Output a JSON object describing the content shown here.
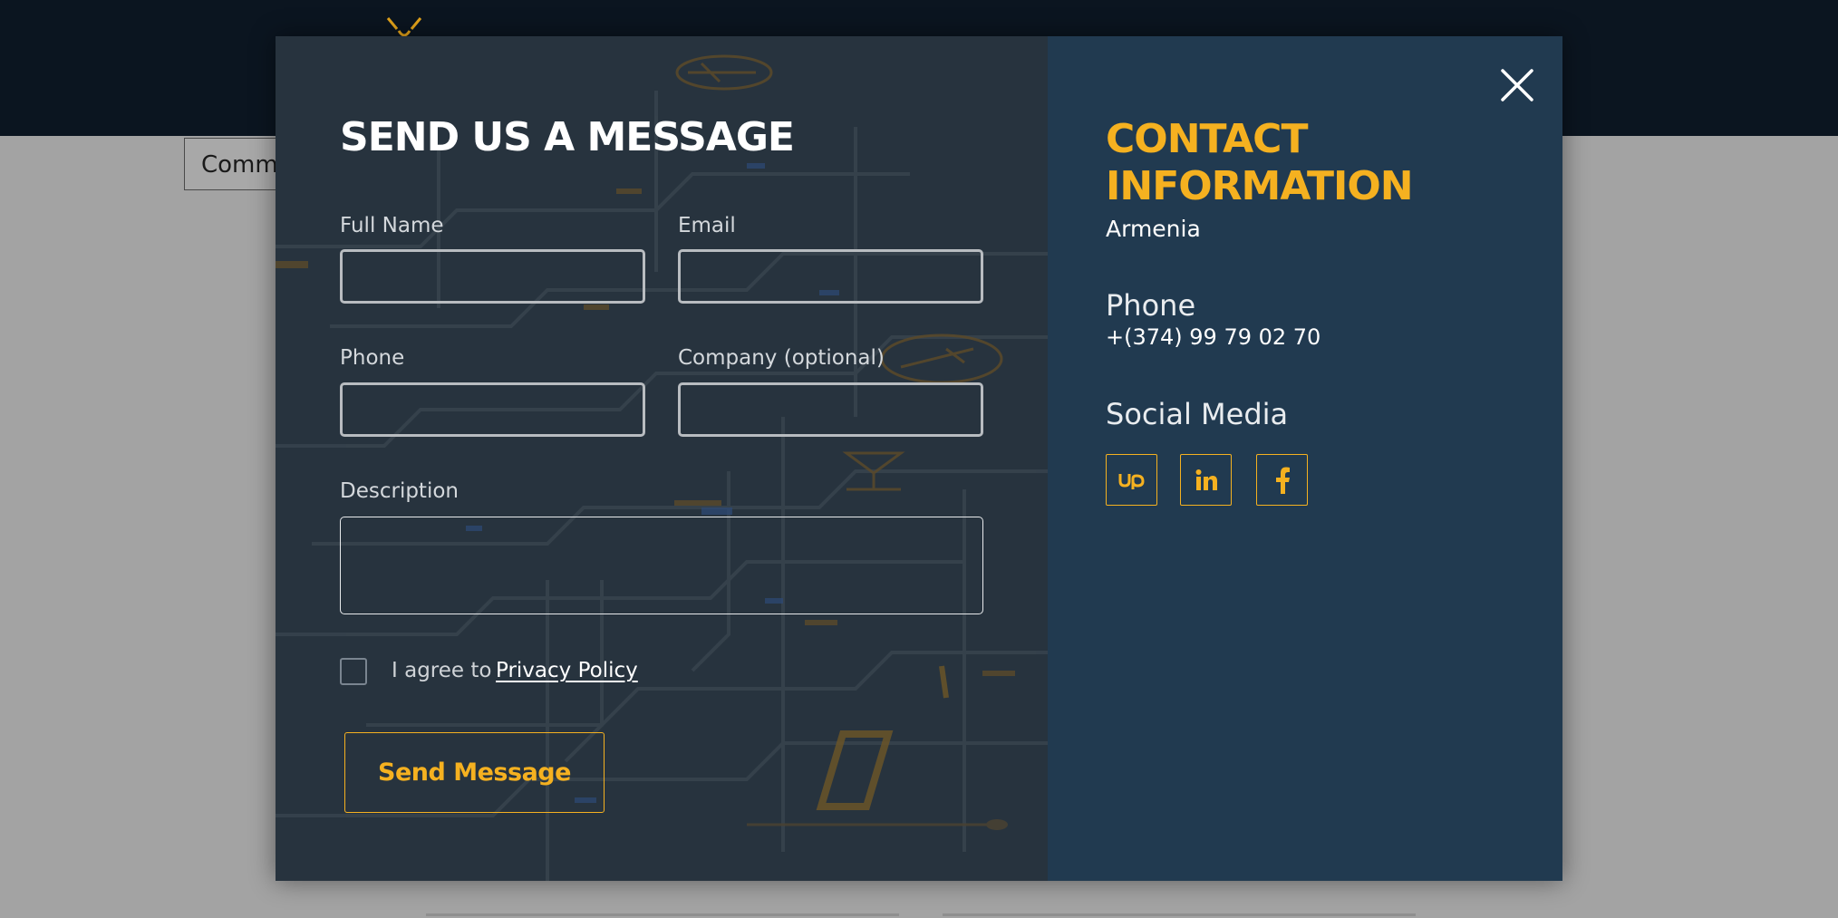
{
  "background": {
    "tab_label": "Commu"
  },
  "form": {
    "title": "SEND US A MESSAGE",
    "full_name_label": "Full Name",
    "email_label": "Email",
    "phone_label": "Phone",
    "company_label": "Company (optional)",
    "description_label": "Description",
    "agree_text": "I agree to",
    "privacy_link": "Privacy Policy",
    "submit_label": "Send Message",
    "values": {
      "full_name": "",
      "email": "",
      "phone": "",
      "company": "",
      "description": ""
    },
    "agree_checked": false
  },
  "contact": {
    "title": "CONTACT INFORMATION",
    "country": "Armenia",
    "phone_heading": "Phone",
    "phone_value": "+(374) 99 79 02 70",
    "social_heading": "Social Media",
    "social_icons": [
      "upwork-icon",
      "linkedin-icon",
      "facebook-icon"
    ]
  },
  "icons": {
    "close": "close-icon"
  },
  "colors": {
    "accent": "#f5b120",
    "topbar": "#0b1520",
    "form_panel": "#27333e",
    "contact_panel": "#213a50",
    "overlay_gray": "#a3a3a3"
  }
}
